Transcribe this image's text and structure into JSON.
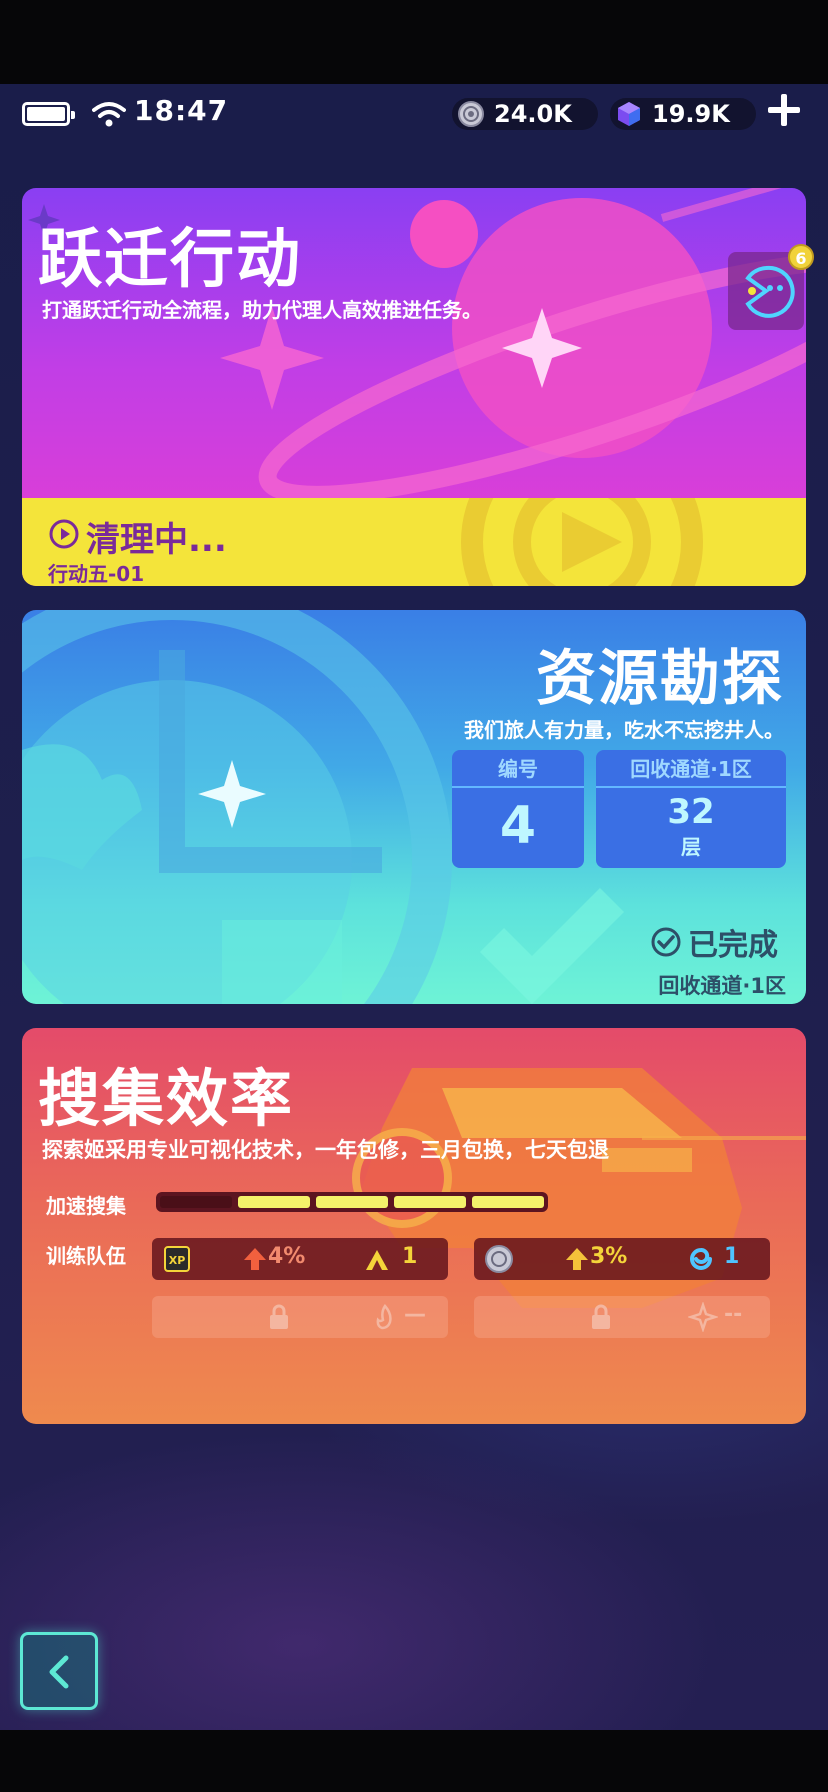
{
  "status_bar": {
    "time": "18:47",
    "currency_1": {
      "icon": "coin-gear-icon",
      "value": "24.0K"
    },
    "currency_2": {
      "icon": "purple-cube-icon",
      "value": "19.9K"
    }
  },
  "card_transition": {
    "title": "跃迁行动",
    "subtitle": "打通跃迁行动全流程，助力代理人高效推进任务。",
    "status": "清理中...",
    "stage": "行动五-01",
    "badge_count": "6"
  },
  "card_resource": {
    "title": "资源勘探",
    "subtitle": "我们旅人有力量，吃水不忘挖井人。",
    "number_label": "编号",
    "number_value": "4",
    "channel_label": "回收通道·1区",
    "floor_value": "32",
    "floor_unit": "层",
    "status": "已完成",
    "location": "回收通道·1区"
  },
  "card_collect": {
    "title": "搜集效率",
    "subtitle": "探索姬采用专业可视化技术，一年包修，三月包换，七天包退",
    "speed_label": "加速搜集",
    "speed_filled_segments": 4,
    "speed_total_segments": 5,
    "team_label": "训练队伍",
    "slot_1": {
      "bonus": "4%",
      "count": "1"
    },
    "slot_2": {
      "bonus": "3%",
      "count": "1"
    },
    "locked_value_1": "—",
    "locked_value_2": "--"
  },
  "colors": {
    "transition_bar": "#f4e43a",
    "speed_fill": "#f4f26a",
    "accent_teal": "#5de8d4"
  }
}
